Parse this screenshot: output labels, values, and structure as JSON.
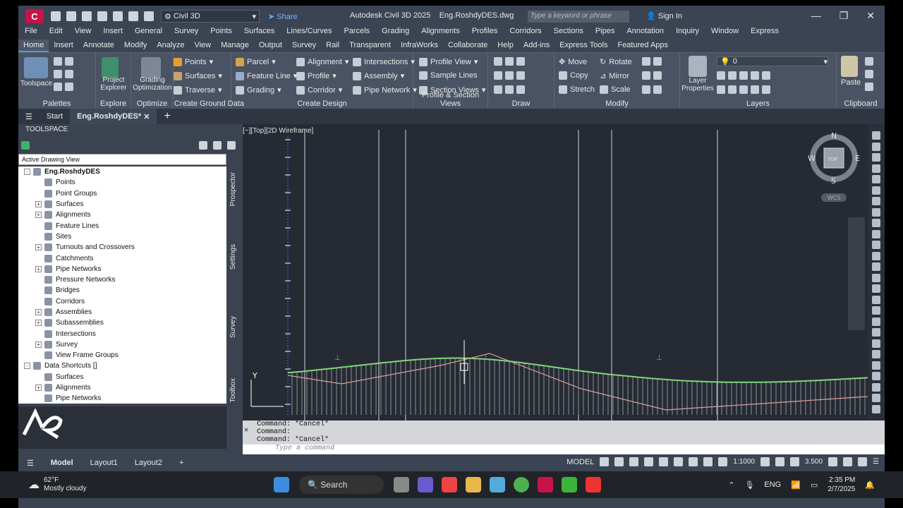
{
  "app": {
    "logo_letter": "C",
    "workspace": "Civil 3D",
    "share_label": "Share",
    "title": "Autodesk Civil 3D 2025",
    "filename": "Eng.RoshdyDES.dwg",
    "search_placeholder": "Type a keyword or phrase",
    "signin_label": "Sign In"
  },
  "menu": [
    "File",
    "Edit",
    "View",
    "Insert",
    "General",
    "Survey",
    "Points",
    "Surfaces",
    "Lines/Curves",
    "Parcels",
    "Grading",
    "Alignments",
    "Profiles",
    "Corridors",
    "Sections",
    "Pipes",
    "Annotation",
    "Inquiry",
    "Window",
    "Express"
  ],
  "ribbon_tabs": [
    "Home",
    "Insert",
    "Annotate",
    "Modify",
    "Analyze",
    "View",
    "Manage",
    "Output",
    "Survey",
    "Rail",
    "Transparent",
    "InfraWorks",
    "Collaborate",
    "Help",
    "Add-ins",
    "Express Tools",
    "Featured Apps"
  ],
  "ribbon": {
    "palettes": {
      "title": "Palettes",
      "toolspace": "Toolspace"
    },
    "explore": {
      "title": "Explore",
      "project_explorer": "Project Explorer"
    },
    "optimize": {
      "title": "Optimize",
      "grading_opt": "Grading Optimization"
    },
    "ground": {
      "title": "Create Ground Data",
      "points": "Points",
      "surfaces": "Surfaces",
      "traverse": "Traverse"
    },
    "design": {
      "title": "Create Design",
      "parcel": "Parcel",
      "feature_line": "Feature Line",
      "grading": "Grading",
      "alignment": "Alignment",
      "profile": "Profile",
      "corridor": "Corridor",
      "intersections": "Intersections",
      "assembly": "Assembly",
      "pipe_network": "Pipe Network"
    },
    "profile_section": {
      "title": "Profile & Section Views",
      "profile_view": "Profile View",
      "sample_lines": "Sample Lines",
      "section_views": "Section Views"
    },
    "draw": {
      "title": "Draw"
    },
    "modify": {
      "title": "Modify",
      "move": "Move",
      "copy": "Copy",
      "stretch": "Stretch",
      "rotate": "Rotate",
      "mirror": "Mirror",
      "scale": "Scale"
    },
    "layers": {
      "title": "Layers",
      "layer_props": "Layer Properties",
      "layer_value": "0"
    },
    "clipboard": {
      "title": "Clipboard",
      "paste": "Paste"
    }
  },
  "doc_tabs": {
    "start": "Start",
    "active": "Eng.RoshdyDES*"
  },
  "toolspace": {
    "header": "TOOLSPACE",
    "view_select": "Active Drawing View",
    "tree": [
      {
        "label": "Eng.RoshdyDES",
        "level": 0,
        "exp": "-",
        "bold": true
      },
      {
        "label": "Points",
        "level": 1,
        "exp": ""
      },
      {
        "label": "Point Groups",
        "level": 1,
        "exp": ""
      },
      {
        "label": "Surfaces",
        "level": 1,
        "exp": "+"
      },
      {
        "label": "Alignments",
        "level": 1,
        "exp": "+"
      },
      {
        "label": "Feature Lines",
        "level": 1,
        "exp": ""
      },
      {
        "label": "Sites",
        "level": 1,
        "exp": ""
      },
      {
        "label": "Turnouts and Crossovers",
        "level": 1,
        "exp": "+"
      },
      {
        "label": "Catchments",
        "level": 1,
        "exp": ""
      },
      {
        "label": "Pipe Networks",
        "level": 1,
        "exp": "+"
      },
      {
        "label": "Pressure Networks",
        "level": 1,
        "exp": ""
      },
      {
        "label": "Bridges",
        "level": 1,
        "exp": ""
      },
      {
        "label": "Corridors",
        "level": 1,
        "exp": ""
      },
      {
        "label": "Assemblies",
        "level": 1,
        "exp": "+"
      },
      {
        "label": "Subassemblies",
        "level": 1,
        "exp": "+"
      },
      {
        "label": "Intersections",
        "level": 1,
        "exp": ""
      },
      {
        "label": "Survey",
        "level": 1,
        "exp": "+"
      },
      {
        "label": "View Frame Groups",
        "level": 1,
        "exp": ""
      },
      {
        "label": "Data Shortcuts []",
        "level": 0,
        "exp": "-"
      },
      {
        "label": "Surfaces",
        "level": 1,
        "exp": ""
      },
      {
        "label": "Alignments",
        "level": 1,
        "exp": "+"
      },
      {
        "label": "Pipe Networks",
        "level": 1,
        "exp": ""
      }
    ],
    "side_tabs": [
      "Prospector",
      "Settings",
      "Survey",
      "Toolbox"
    ]
  },
  "viewport": {
    "label": "[−][Top][2D Wireframe]",
    "compass": {
      "n": "N",
      "s": "S",
      "e": "E",
      "w": "W",
      "top": "TOP"
    },
    "wcs": "WCS",
    "ucs_y": "Y"
  },
  "command": {
    "lines": [
      "Command: *Cancel*",
      "Command:",
      "Command: *Cancel*"
    ],
    "placeholder": "Type a command"
  },
  "status": {
    "model": "Model",
    "layout1": "Layout1",
    "layout2": "Layout2",
    "model_btn": "MODEL",
    "scale": "1:1000",
    "value": "3.500"
  },
  "taskbar": {
    "weather_temp": "62°F",
    "weather_desc": "Mostly cloudy",
    "search": "Search",
    "lang": "ENG",
    "time": "2:35 PM",
    "date": "2/7/2025"
  },
  "colors": {
    "accent": "#c8134a",
    "viewport": "#262b33",
    "profile": "#7fd67a",
    "ribbon": "#4a5363"
  }
}
